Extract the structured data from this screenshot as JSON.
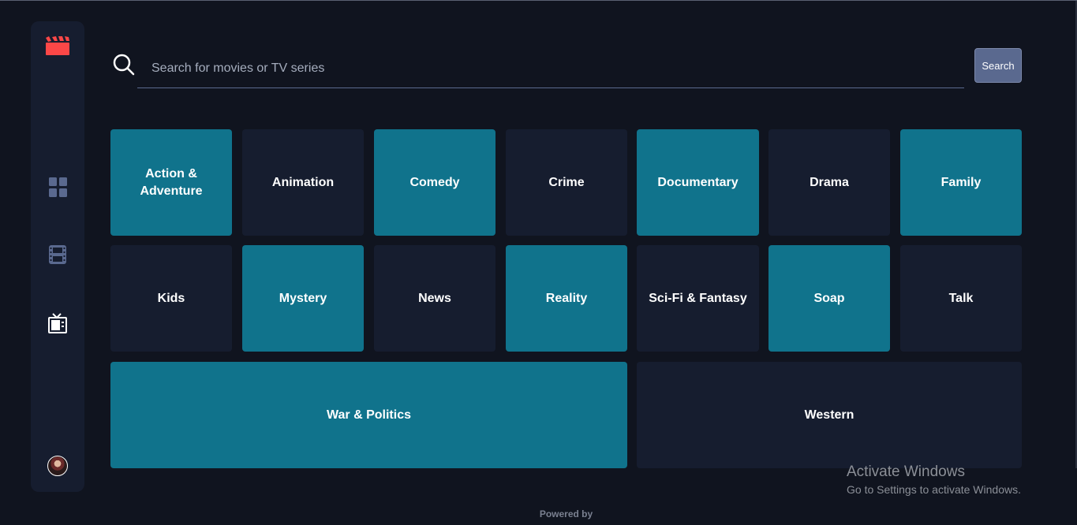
{
  "sidebar": {
    "logo_icon": "clapperboard-icon",
    "logo_color": "#fc4747",
    "nav": [
      {
        "icon": "grid-icon",
        "name": "Home"
      },
      {
        "icon": "film-icon",
        "name": "Movies"
      },
      {
        "icon": "tv-icon",
        "name": "TV Series",
        "active": true
      }
    ],
    "avatar_icon": "avatar"
  },
  "search": {
    "placeholder": "Search for movies or TV series",
    "value": "",
    "button_label": "Search"
  },
  "genres": [
    {
      "label": "Action & Adventure",
      "style": "teal"
    },
    {
      "label": "Animation",
      "style": "navy"
    },
    {
      "label": "Comedy",
      "style": "teal"
    },
    {
      "label": "Crime",
      "style": "navy"
    },
    {
      "label": "Documentary",
      "style": "teal"
    },
    {
      "label": "Drama",
      "style": "navy"
    },
    {
      "label": "Family",
      "style": "teal"
    },
    {
      "label": "Kids",
      "style": "navy"
    },
    {
      "label": "Mystery",
      "style": "teal"
    },
    {
      "label": "News",
      "style": "navy"
    },
    {
      "label": "Reality",
      "style": "teal"
    },
    {
      "label": "Sci-Fi & Fantasy",
      "style": "navy"
    },
    {
      "label": "Soap",
      "style": "teal"
    },
    {
      "label": "Talk",
      "style": "navy"
    },
    {
      "label": "War & Politics",
      "style": "teal"
    },
    {
      "label": "Western",
      "style": "navy"
    }
  ],
  "footer": {
    "powered_by": "Powered by"
  },
  "watermark": {
    "title": "Activate Windows",
    "subtitle": "Go to Settings to activate Windows."
  },
  "colors": {
    "background": "#10141f",
    "panel": "#161d2f",
    "teal": "#10738c",
    "accent_red": "#fc4747",
    "muted": "#5a698f"
  }
}
